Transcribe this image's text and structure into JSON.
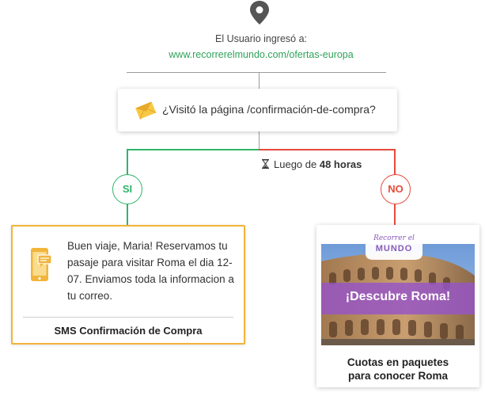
{
  "trigger": {
    "label": "El Usuario ingresó a:",
    "url": "www.recorrerelmundo.com/ofertas-europa",
    "icon": "location-pin-icon"
  },
  "condition": {
    "text": "¿Visitó la página /confirmación-de-compra?",
    "icon": "email-envelope-icon"
  },
  "delay": {
    "prefix": "Luego de",
    "value": "48 horas",
    "icon": "hourglass-icon"
  },
  "branches": {
    "yes": {
      "label": "SI",
      "color": "#2fb56a"
    },
    "no": {
      "label": "NO",
      "color": "#e64a3b"
    }
  },
  "sms_card": {
    "message": "Buen viaje, Maria! Reservamos tu pasaje para visitar Roma el dia 12-07. Enviamos toda la informacion a tu correo.",
    "title": "SMS Confirmación de Compra",
    "border_color": "#f2b43a",
    "icon": "mobile-sms-icon"
  },
  "email_card": {
    "brand_script": "Recorrer el",
    "brand_word": "MUNDO",
    "promo": "¡Descubre Roma!",
    "caption_line1": "Cuotas en paquetes",
    "caption_line2": "para conocer Roma",
    "accent": "#9654c8"
  }
}
